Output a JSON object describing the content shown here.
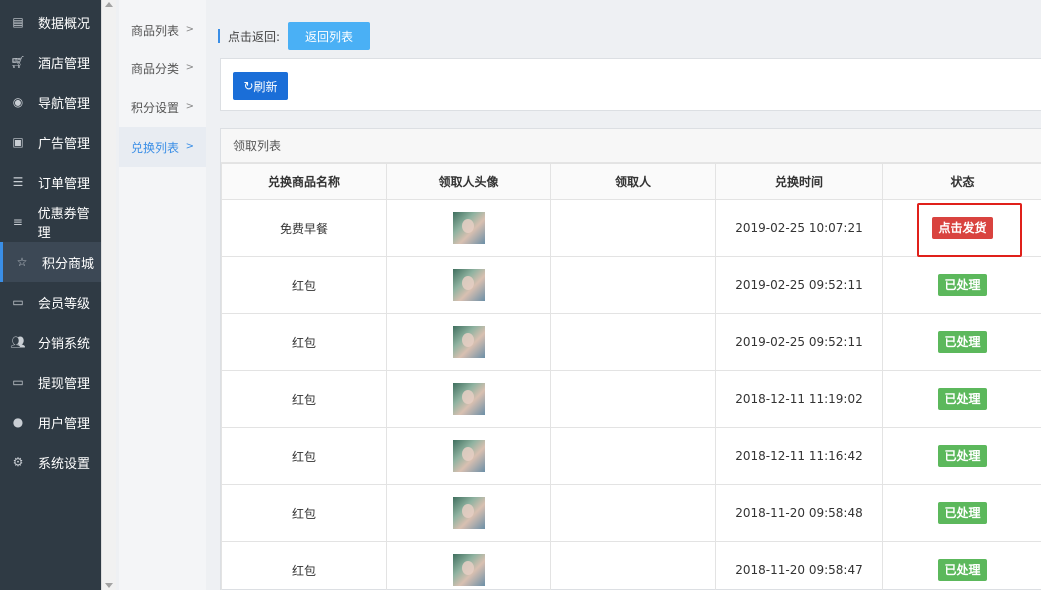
{
  "sidebar": {
    "items": [
      {
        "label": "数据概况",
        "icon": "dashboard-icon"
      },
      {
        "label": "酒店管理",
        "icon": "cart-icon"
      },
      {
        "label": "导航管理",
        "icon": "compass-icon"
      },
      {
        "label": "广告管理",
        "icon": "gift-icon"
      },
      {
        "label": "订单管理",
        "icon": "server-icon"
      },
      {
        "label": "优惠券管理",
        "icon": "menu-lines-icon"
      },
      {
        "label": "积分商城",
        "icon": "star-icon",
        "active": true
      },
      {
        "label": "会员等级",
        "icon": "money-icon"
      },
      {
        "label": "分销系统",
        "icon": "users-icon"
      },
      {
        "label": "提现管理",
        "icon": "money-icon"
      },
      {
        "label": "用户管理",
        "icon": "user-icon"
      },
      {
        "label": "系统设置",
        "icon": "gear-icon"
      }
    ]
  },
  "submenu": {
    "items": [
      {
        "label": "商品列表"
      },
      {
        "label": "商品分类"
      },
      {
        "label": "积分设置"
      },
      {
        "label": "兑换列表",
        "active": true
      }
    ]
  },
  "backbar": {
    "label": "点击返回:",
    "button": "返回列表"
  },
  "toolbar": {
    "refresh_label": "刷新"
  },
  "list": {
    "title": "领取列表",
    "headers": [
      "兑换商品名称",
      "领取人头像",
      "领取人",
      "兑换时间",
      "状态"
    ],
    "rows": [
      {
        "name": "免费早餐",
        "receiver": "",
        "time": "2019-02-25 10:07:21",
        "status": "点击发货",
        "status_type": "pending"
      },
      {
        "name": "红包",
        "receiver": "",
        "time": "2019-02-25 09:52:11",
        "status": "已处理",
        "status_type": "done"
      },
      {
        "name": "红包",
        "receiver": "",
        "time": "2019-02-25 09:52:11",
        "status": "已处理",
        "status_type": "done"
      },
      {
        "name": "红包",
        "receiver": "",
        "time": "2018-12-11 11:19:02",
        "status": "已处理",
        "status_type": "done"
      },
      {
        "name": "红包",
        "receiver": "",
        "time": "2018-12-11 11:16:42",
        "status": "已处理",
        "status_type": "done"
      },
      {
        "name": "红包",
        "receiver": "",
        "time": "2018-11-20 09:58:48",
        "status": "已处理",
        "status_type": "done"
      },
      {
        "name": "红包",
        "receiver": "",
        "time": "2018-11-20 09:58:47",
        "status": "已处理",
        "status_type": "done"
      }
    ]
  },
  "colors": {
    "sidebar_bg": "#2f3a44",
    "accent": "#3a8ee6",
    "back_button": "#4ab0f5",
    "refresh_button": "#1a6ed8",
    "pending": "#d9433f",
    "done": "#5cb85c",
    "highlight": "#e0201a"
  }
}
